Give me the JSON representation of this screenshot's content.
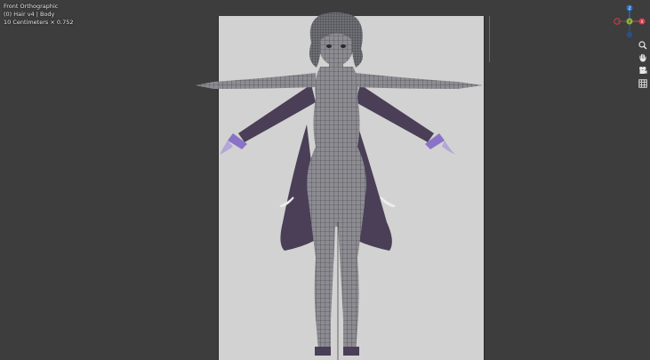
{
  "viewport": {
    "view_name": "Front Orthographic",
    "collection_info": "(0) Hair v4 | Body",
    "scale_info": "10 Centimeters × 0.752"
  },
  "gizmo": {
    "axes": [
      {
        "label": "Z",
        "color": "#2c6fc4"
      },
      {
        "label": "Y",
        "color": "#8ab834"
      },
      {
        "label": "X",
        "color": "#d63d4e"
      }
    ]
  },
  "nav_tools": [
    {
      "name": "zoom-icon"
    },
    {
      "name": "pan-hand-icon"
    },
    {
      "name": "camera-icon"
    },
    {
      "name": "grid-icon"
    }
  ],
  "colors": {
    "background": "#3d3d3d",
    "reference_bg": "#d2d2d2",
    "mesh_body": "#7c7c82",
    "cloak": "#4a3f57",
    "accent_purple": "#8a72c6"
  }
}
